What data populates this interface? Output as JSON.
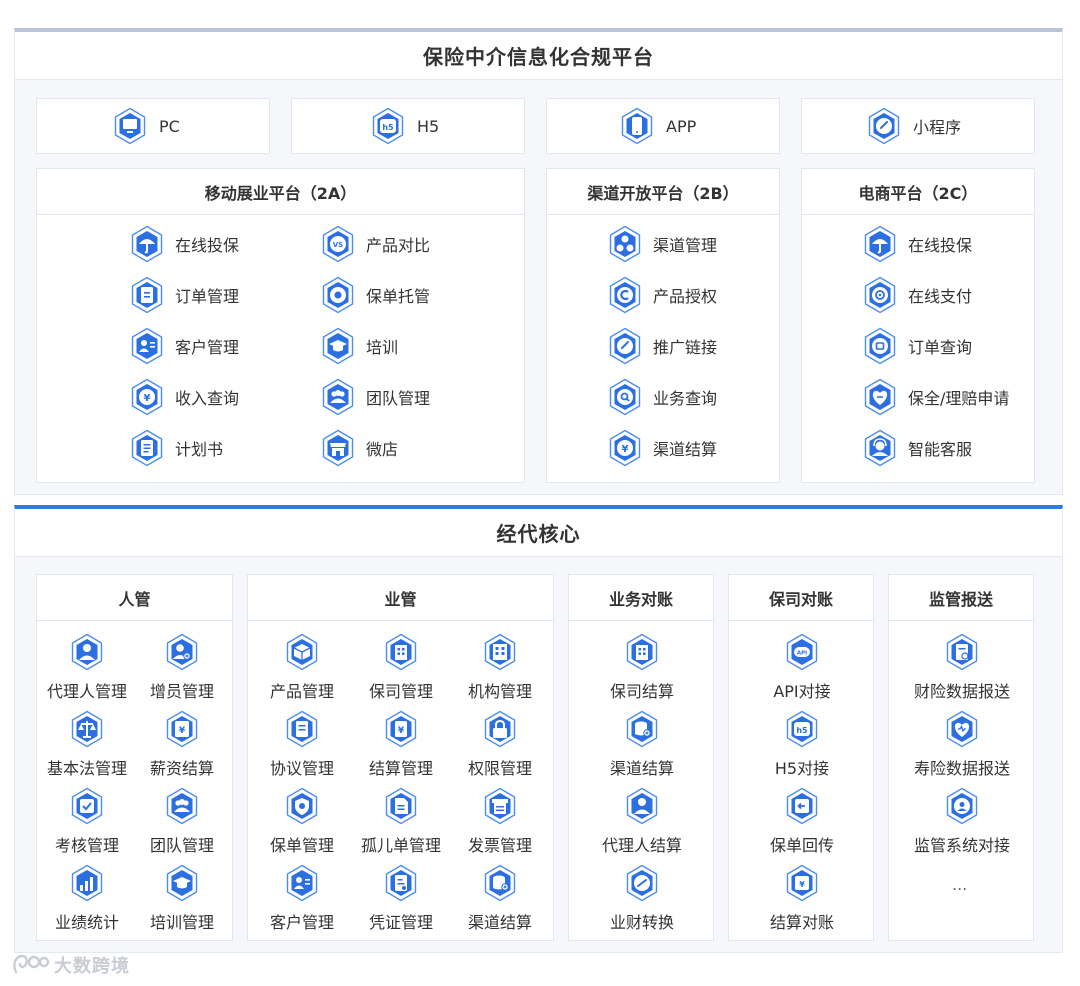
{
  "top": {
    "title": "保险中介信息化合规平台",
    "channels": [
      {
        "label": "PC",
        "icon": "monitor-icon"
      },
      {
        "label": "H5",
        "icon": "h5-icon"
      },
      {
        "label": "APP",
        "icon": "phone-icon"
      },
      {
        "label": "小程序",
        "icon": "link-icon"
      }
    ],
    "platforms": [
      {
        "title": "移动展业平台（2A）",
        "items": [
          {
            "label": "在线投保",
            "icon": "umbrella-icon"
          },
          {
            "label": "产品对比",
            "icon": "vs-icon"
          },
          {
            "label": "订单管理",
            "icon": "clipboard-icon"
          },
          {
            "label": "保单托管",
            "icon": "policy-icon"
          },
          {
            "label": "客户管理",
            "icon": "contact-card-icon"
          },
          {
            "label": "培训",
            "icon": "graduation-cap-icon"
          },
          {
            "label": "收入查询",
            "icon": "yen-coin-icon"
          },
          {
            "label": "团队管理",
            "icon": "team-icon"
          },
          {
            "label": "计划书",
            "icon": "document-icon"
          },
          {
            "label": "微店",
            "icon": "shop-icon"
          }
        ]
      },
      {
        "title": "渠道开放平台（2B）",
        "items": [
          {
            "label": "渠道管理",
            "icon": "nodes-icon"
          },
          {
            "label": "产品授权",
            "icon": "authorize-icon"
          },
          {
            "label": "推广链接",
            "icon": "link-icon"
          },
          {
            "label": "业务查询",
            "icon": "search-icon"
          },
          {
            "label": "渠道结算",
            "icon": "yen-coin-icon"
          }
        ]
      },
      {
        "title": "电商平台（2C）",
        "items": [
          {
            "label": "在线投保",
            "icon": "umbrella-icon"
          },
          {
            "label": "在线支付",
            "icon": "pay-icon"
          },
          {
            "label": "订单查询",
            "icon": "order-icon"
          },
          {
            "label": "保全/理赔申请",
            "icon": "heart-hand-icon"
          },
          {
            "label": "智能客服",
            "icon": "service-icon"
          }
        ]
      }
    ]
  },
  "core": {
    "title": "经代核心",
    "sections": [
      {
        "title": "人管",
        "items": [
          {
            "label": "代理人管理",
            "icon": "person-icon"
          },
          {
            "label": "增员管理",
            "icon": "add-person-icon"
          },
          {
            "label": "基本法管理",
            "icon": "scale-icon"
          },
          {
            "label": "薪资结算",
            "icon": "salary-icon"
          },
          {
            "label": "考核管理",
            "icon": "check-icon"
          },
          {
            "label": "团队管理",
            "icon": "team-icon"
          },
          {
            "label": "业绩统计",
            "icon": "chart-icon"
          },
          {
            "label": "培训管理",
            "icon": "graduation-cap-icon"
          }
        ]
      },
      {
        "title": "业管",
        "items": [
          {
            "label": "产品管理",
            "icon": "box-icon"
          },
          {
            "label": "保司管理",
            "icon": "building-icon"
          },
          {
            "label": "机构管理",
            "icon": "office-icon"
          },
          {
            "label": "协议管理",
            "icon": "agreement-icon"
          },
          {
            "label": "结算管理",
            "icon": "settlement-icon"
          },
          {
            "label": "权限管理",
            "icon": "lock-icon"
          },
          {
            "label": "保单管理",
            "icon": "shield-icon"
          },
          {
            "label": "孤儿单管理",
            "icon": "file-icon"
          },
          {
            "label": "发票管理",
            "icon": "invoice-icon"
          },
          {
            "label": "客户管理",
            "icon": "contact-card-icon"
          },
          {
            "label": "凭证管理",
            "icon": "voucher-icon"
          },
          {
            "label": "渠道结算",
            "icon": "database-icon"
          }
        ]
      },
      {
        "title": "业务对账",
        "items": [
          {
            "label": "保司结算",
            "icon": "building-icon"
          },
          {
            "label": "渠道结算",
            "icon": "database-icon"
          },
          {
            "label": "代理人结算",
            "icon": "person-icon"
          },
          {
            "label": "业财转换",
            "icon": "exchange-icon"
          }
        ]
      },
      {
        "title": "保司对账",
        "items": [
          {
            "label": "API对接",
            "icon": "api-icon"
          },
          {
            "label": "H5对接",
            "icon": "h5-icon"
          },
          {
            "label": "保单回传",
            "icon": "return-icon"
          },
          {
            "label": "结算对账",
            "icon": "reconcile-icon"
          }
        ]
      },
      {
        "title": "监管报送",
        "items": [
          {
            "label": "财险数据报送",
            "icon": "report-icon"
          },
          {
            "label": "寿险数据报送",
            "icon": "heart-icon"
          },
          {
            "label": "监管系统对接",
            "icon": "regulator-icon"
          }
        ],
        "ellipsis": "..."
      }
    ]
  },
  "watermark": "大数跨境",
  "colors": {
    "accent": "#2a7de1",
    "hex_fill": "#2b6fe0",
    "hex_stroke": "#4a8cf0"
  }
}
